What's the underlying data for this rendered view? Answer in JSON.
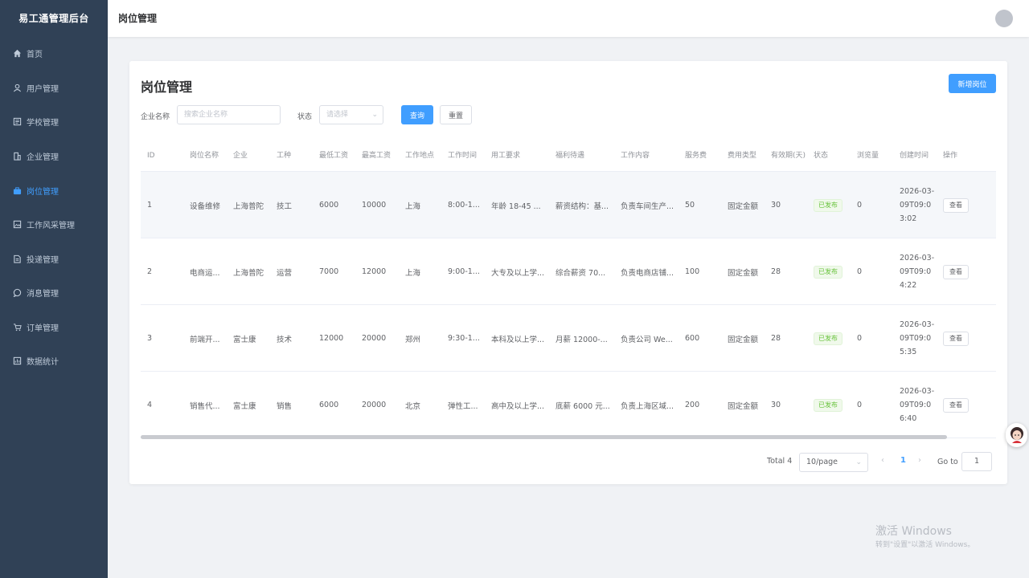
{
  "app": {
    "title": "易工通管理后台"
  },
  "header": {
    "title": "岗位管理"
  },
  "sidebar": {
    "items": [
      {
        "label": "首页",
        "icon": "home-icon"
      },
      {
        "label": "用户管理",
        "icon": "user-icon"
      },
      {
        "label": "学校管理",
        "icon": "school-icon"
      },
      {
        "label": "企业管理",
        "icon": "building-icon"
      },
      {
        "label": "岗位管理",
        "icon": "briefcase-icon",
        "active": true
      },
      {
        "label": "工作风采管理",
        "icon": "image-icon"
      },
      {
        "label": "投递管理",
        "icon": "document-icon"
      },
      {
        "label": "消息管理",
        "icon": "chat-icon"
      },
      {
        "label": "订单管理",
        "icon": "cart-icon"
      },
      {
        "label": "数据统计",
        "icon": "chart-icon"
      }
    ]
  },
  "page": {
    "title": "岗位管理",
    "new_button": "新增岗位",
    "filters": {
      "company_label": "企业名称",
      "company_placeholder": "搜索企业名称",
      "status_label": "状态",
      "status_placeholder": "请选择",
      "query_button": "查询",
      "reset_button": "重置"
    }
  },
  "table": {
    "headers": [
      "ID",
      "岗位名称",
      "企业",
      "工种",
      "最低工资",
      "最高工资",
      "工作地点",
      "工作时间",
      "用工要求",
      "福利待遇",
      "工作内容",
      "服务费",
      "费用类型",
      "有效期(天)",
      "状态",
      "浏览量",
      "创建时间",
      "操作"
    ],
    "rows": [
      [
        "1",
        "设备维修",
        "上海普陀",
        "技工",
        "6000",
        "10000",
        "上海",
        "8:00-1...",
        "年龄 18-45 ...",
        "薪资结构：基...",
        "负责车间生产...",
        "50",
        "固定金额",
        "30",
        "已发布",
        "0",
        "2026-03-09T09:03:02",
        "查看"
      ],
      [
        "2",
        "电商运...",
        "上海普陀",
        "运营",
        "7000",
        "12000",
        "上海",
        "9:00-1...",
        "大专及以上学...",
        "综合薪资 70...",
        "负责电商店铺...",
        "100",
        "固定金额",
        "28",
        "已发布",
        "0",
        "2026-03-09T09:04:22",
        "查看"
      ],
      [
        "3",
        "前端开...",
        "富士康",
        "技术",
        "12000",
        "20000",
        "郑州",
        "9:30-1...",
        "本科及以上学...",
        "月薪 12000-...",
        "负责公司 We...",
        "600",
        "固定金额",
        "28",
        "已发布",
        "0",
        "2026-03-09T09:05:35",
        "查看"
      ],
      [
        "4",
        "销售代...",
        "富士康",
        "销售",
        "6000",
        "20000",
        "北京",
        "弹性工...",
        "高中及以上学...",
        "底薪 6000 元...",
        "负责上海区域...",
        "200",
        "固定金额",
        "30",
        "已发布",
        "0",
        "2026-03-09T09:06:40",
        "查看"
      ]
    ]
  },
  "pagination": {
    "total": "Total 4",
    "page_size": "10/page",
    "current_page": "1",
    "goto_label": "Go to",
    "goto_value": "1"
  },
  "watermark": {
    "title": "激活 Windows",
    "subtitle": "转到\"设置\"以激活 Windows。"
  },
  "colors": {
    "sidebar_bg": "#304156",
    "sidebar_text": "#bfcbd9",
    "primary": "#409eff",
    "success": "#67c23a"
  }
}
